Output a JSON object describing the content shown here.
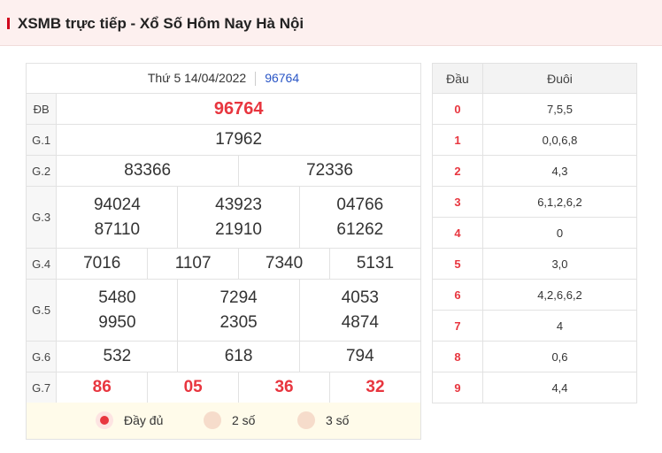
{
  "header": {
    "title": "XSMB trực tiếp - Xổ Số Hôm Nay Hà Nội"
  },
  "results": {
    "date": "Thứ 5 14/04/2022",
    "code": "96764",
    "special_label": "ĐB",
    "special": "96764",
    "g1_label": "G.1",
    "g1": "17962",
    "g2_label": "G.2",
    "g2": [
      "83366",
      "72336"
    ],
    "g3_label": "G.3",
    "g3": [
      "94024",
      "43923",
      "04766",
      "87110",
      "21910",
      "61262"
    ],
    "g4_label": "G.4",
    "g4": [
      "7016",
      "1107",
      "7340",
      "5131"
    ],
    "g5_label": "G.5",
    "g5": [
      "5480",
      "7294",
      "4053",
      "9950",
      "2305",
      "4874"
    ],
    "g6_label": "G.6",
    "g6": [
      "532",
      "618",
      "794"
    ],
    "g7_label": "G.7",
    "g7": [
      "86",
      "05",
      "36",
      "32"
    ]
  },
  "display_options": {
    "full": "Đầy đủ",
    "two": "2 số",
    "three": "3 số",
    "selected": "full"
  },
  "dau_duoi": {
    "head_label": "Đầu",
    "tail_label": "Đuôi",
    "rows": [
      {
        "dau": "0",
        "duoi": "7,5,5"
      },
      {
        "dau": "1",
        "duoi": "0,0,6,8"
      },
      {
        "dau": "2",
        "duoi": "4,3"
      },
      {
        "dau": "3",
        "duoi": "6,1,2,6,2"
      },
      {
        "dau": "4",
        "duoi": "0"
      },
      {
        "dau": "5",
        "duoi": "3,0"
      },
      {
        "dau": "6",
        "duoi": "4,2,6,6,2"
      },
      {
        "dau": "7",
        "duoi": "4"
      },
      {
        "dau": "8",
        "duoi": "0,6"
      },
      {
        "dau": "9",
        "duoi": "4,4"
      }
    ]
  },
  "colors": {
    "accent": "#e8363f",
    "link": "#2a56c6",
    "header_bg": "#fdf0ef"
  }
}
